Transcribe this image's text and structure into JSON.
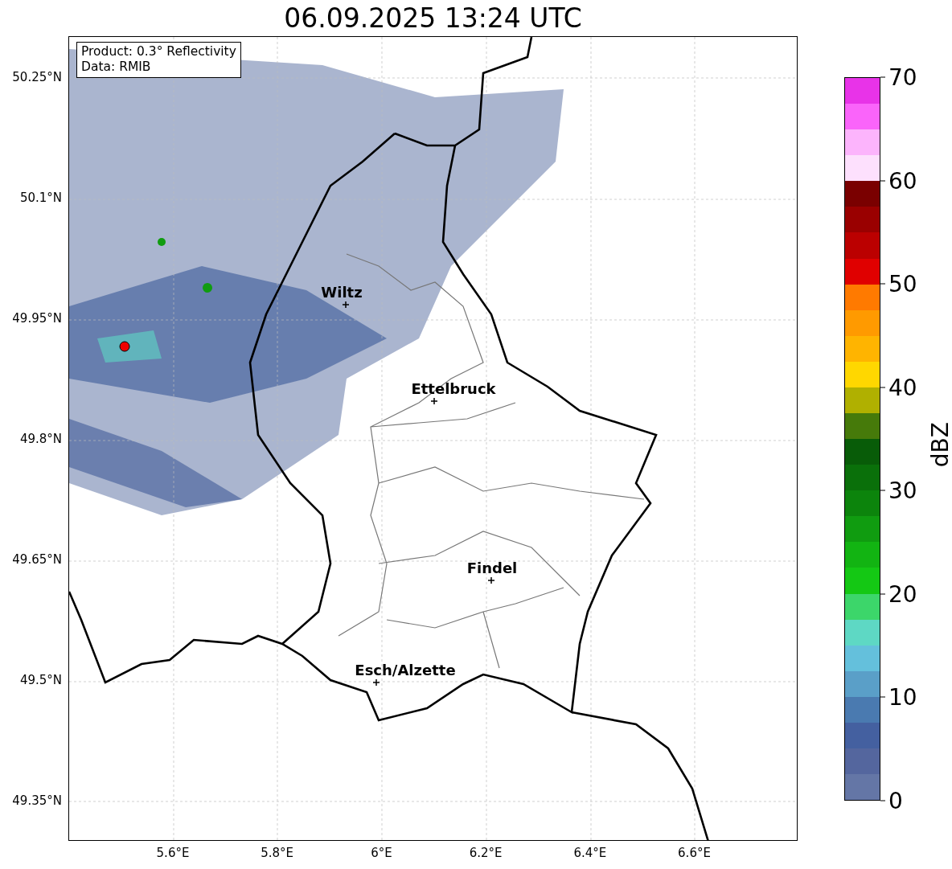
{
  "title": "06.09.2025 13:24 UTC",
  "info_box": [
    "Product: 0.3° Reflectivity",
    "Data: RMIB"
  ],
  "map": {
    "cities": [
      {
        "name": "Wiltz"
      },
      {
        "name": "Ettelbruck"
      },
      {
        "name": "Findel"
      },
      {
        "name": "Esch/Alzette"
      }
    ]
  },
  "lat_ticks": [
    "50.25°N",
    "50.1°N",
    "49.95°N",
    "49.8°N",
    "49.65°N",
    "49.5°N",
    "49.35°N"
  ],
  "lon_ticks": [
    "5.6°E",
    "5.8°E",
    "6°E",
    "6.2°E",
    "6.4°E",
    "6.6°E"
  ],
  "colorbar": {
    "label": "dBZ",
    "ticks": [
      "70",
      "60",
      "50",
      "40",
      "30",
      "20",
      "10",
      "0"
    ],
    "bins": [
      {
        "color": "#e833e8"
      },
      {
        "color": "#fa64fa"
      },
      {
        "color": "#fcb4fc"
      },
      {
        "color": "#fde0fd"
      },
      {
        "color": "#7a0000"
      },
      {
        "color": "#9a0000"
      },
      {
        "color": "#bb0000"
      },
      {
        "color": "#e00000"
      },
      {
        "color": "#ff7a00"
      },
      {
        "color": "#ff9a00"
      },
      {
        "color": "#ffb400"
      },
      {
        "color": "#ffd700"
      },
      {
        "color": "#b0b000"
      },
      {
        "color": "#467a0a"
      },
      {
        "color": "#085c08"
      },
      {
        "color": "#0a700a"
      },
      {
        "color": "#0c840c"
      },
      {
        "color": "#109c10"
      },
      {
        "color": "#12b412"
      },
      {
        "color": "#14c814"
      },
      {
        "color": "#3cd66a"
      },
      {
        "color": "#5ed8c4"
      },
      {
        "color": "#64c0dc"
      },
      {
        "color": "#5a9fc8"
      },
      {
        "color": "#4a7ab0"
      },
      {
        "color": "#4460a0"
      },
      {
        "color": "#54669e"
      },
      {
        "color": "#6476a6"
      }
    ]
  }
}
